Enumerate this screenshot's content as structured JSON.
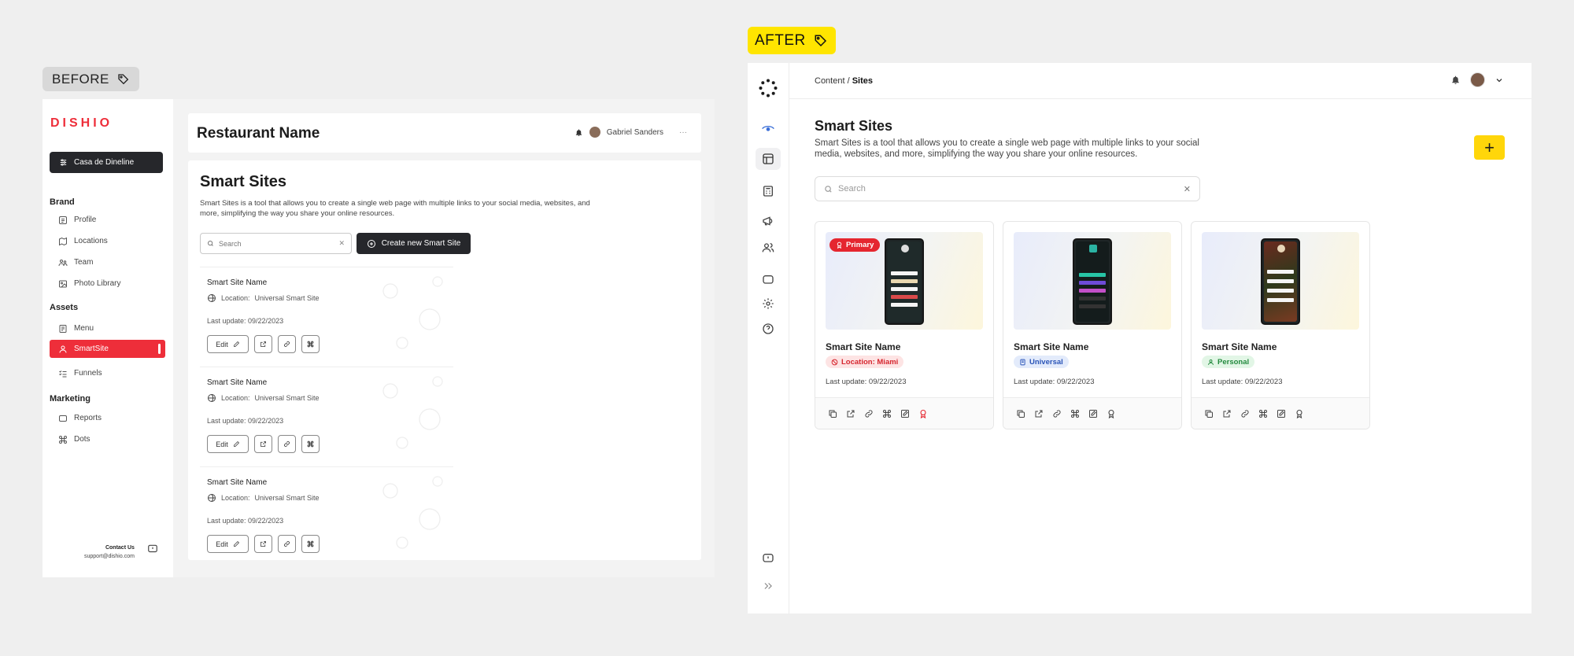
{
  "labels": {
    "before": "BEFORE",
    "after": "AFTER"
  },
  "before": {
    "brand": "DISHIO",
    "restaurant_selector": "Casa de Dineline",
    "sections": [
      {
        "title": "Brand",
        "items": [
          "Profile",
          "Locations",
          "Team",
          "Photo Library"
        ]
      },
      {
        "title": "Assets",
        "items": [
          "Menu",
          "SmartSite",
          "Funnels"
        ]
      },
      {
        "title": "Marketing",
        "items": [
          "Reports",
          "Dots"
        ]
      }
    ],
    "active_item": "SmartSite",
    "contact": {
      "label": "Contact Us",
      "email": "support@dishio.com"
    },
    "header": {
      "restaurant_name": "Restaurant Name",
      "user_name": "Gabriel Sanders"
    },
    "page": {
      "title": "Smart Sites",
      "description": "Smart Sites is a tool that allows you to create a single web page with multiple links to your social media, websites, and more, simplifying the way you share your online resources.",
      "search_placeholder": "Search",
      "create_button": "Create new Smart Site"
    },
    "cards": [
      {
        "name": "Smart Site Name",
        "location_label": "Location:",
        "location_value": "Universal Smart Site",
        "updated": "Last update: 09/22/2023",
        "edit_label": "Edit"
      },
      {
        "name": "Smart Site Name",
        "location_label": "Location:",
        "location_value": "Universal Smart Site",
        "updated": "Last update: 09/22/2023",
        "edit_label": "Edit"
      },
      {
        "name": "Smart Site Name",
        "location_label": "Location:",
        "location_value": "Universal Smart Site",
        "updated": "Last update: 09/22/2023",
        "edit_label": "Edit"
      }
    ]
  },
  "after": {
    "breadcrumb": {
      "parent": "Content / ",
      "current": "Sites"
    },
    "page": {
      "title": "Smart Sites",
      "description": "Smart Sites is a tool that allows you to create a single web page with multiple links to your social media, websites, and more, simplifying the way you share your online resources.",
      "search_placeholder": "Search",
      "add_symbol": "+"
    },
    "cards": [
      {
        "name": "Smart Site Name",
        "badge": "Location: Miami",
        "badge_kind": "location",
        "updated": "Last update: 09/22/2023",
        "primary_label": "Primary"
      },
      {
        "name": "Smart Site Name",
        "badge": "Universal",
        "badge_kind": "universal",
        "updated": "Last update: 09/22/2023"
      },
      {
        "name": "Smart Site Name",
        "badge": "Personal",
        "badge_kind": "personal",
        "updated": "Last update: 09/22/2023"
      }
    ],
    "colors": {
      "accent_yellow": "#ffd60a",
      "primary_red": "#e5262f",
      "brand_red": "#ee2e3a"
    }
  }
}
